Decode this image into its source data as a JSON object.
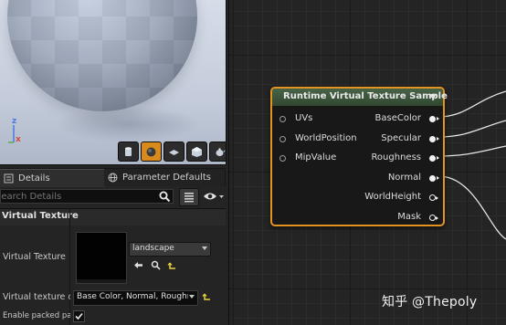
{
  "viewport": {
    "axes": {
      "z": "z",
      "x": "x"
    },
    "preview_shapes": [
      "cylinder-icon",
      "sphere-icon",
      "plane-icon",
      "cube-icon",
      "teapot-icon"
    ]
  },
  "tabs": [
    {
      "label": "Details",
      "icon": "details-icon",
      "active": true
    },
    {
      "label": "Parameter Defaults",
      "icon": "globe-icon",
      "active": false
    }
  ],
  "search": {
    "placeholder": "Search Details"
  },
  "section": {
    "title": "Virtual Texture"
  },
  "properties": {
    "virtual_texture": {
      "label": "Virtual Texture",
      "value": "landscape"
    },
    "virtual_texture_content": {
      "label": "Virtual texture co",
      "value": "Base Color, Normal, Roughne"
    },
    "enable_packed": {
      "label": "Enable packed pa",
      "checked": true
    }
  },
  "node": {
    "title": "Runtime Virtual Texture Sample",
    "inputs": [
      "UVs",
      "WorldPosition",
      "MipValue"
    ],
    "outputs": [
      "BaseColor",
      "Specular",
      "Roughness",
      "Normal",
      "WorldHeight",
      "Mask"
    ],
    "border_color": "#e39420",
    "header_color": "#3b553a"
  },
  "watermark": "知乎 @Thepoly"
}
